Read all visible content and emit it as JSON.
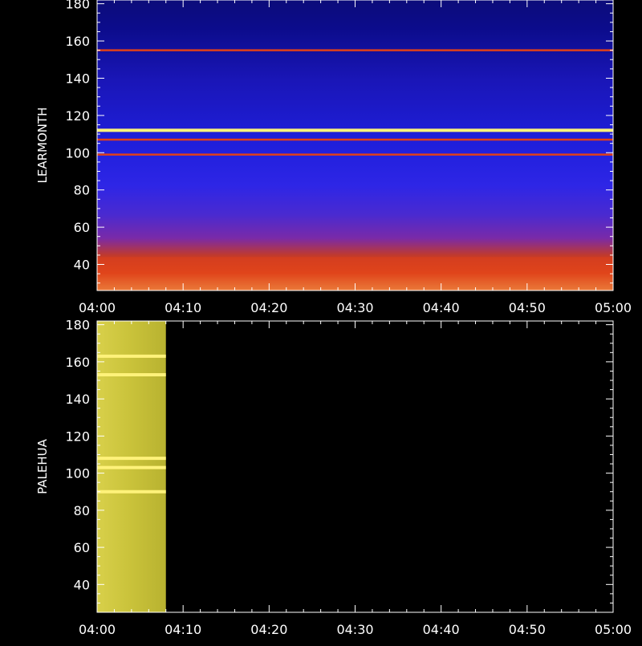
{
  "colors": {
    "background": "#000000",
    "axis": "#ffffff",
    "low_power": "#0a0a80",
    "mid_power": "#3a2ae0",
    "high_power": "#e0401a",
    "saturation": "#fff27a"
  },
  "chart_data": [
    {
      "type": "heatmap",
      "title": "",
      "ylabel": "LEARMONTH",
      "xlabel": "",
      "x_start": "04:00",
      "x_end": "05:00",
      "xticks": [
        "04:00",
        "04:10",
        "04:20",
        "04:30",
        "04:40",
        "04:50",
        "05:00"
      ],
      "ylim": [
        26,
        182
      ],
      "yticks": [
        40,
        60,
        80,
        100,
        120,
        140,
        160,
        180
      ],
      "colormap": "blue-red-yellow",
      "data_coverage": [
        "04:00",
        "05:00"
      ],
      "features": [
        {
          "kind": "line",
          "freq": 112,
          "level": "saturated"
        },
        {
          "kind": "line",
          "freq": 155,
          "level": "high"
        },
        {
          "kind": "line",
          "freq": 107,
          "level": "high"
        },
        {
          "kind": "line",
          "freq": 99,
          "level": "high"
        },
        {
          "kind": "band",
          "freq_range": [
            26,
            44
          ],
          "level": "high"
        }
      ]
    },
    {
      "type": "heatmap",
      "title": "",
      "ylabel": "PALEHUA",
      "xlabel": "",
      "x_start": "04:00",
      "x_end": "05:00",
      "xticks": [
        "04:00",
        "04:10",
        "04:20",
        "04:30",
        "04:40",
        "04:50",
        "05:00"
      ],
      "ylim": [
        25,
        182
      ],
      "yticks": [
        40,
        60,
        80,
        100,
        120,
        140,
        160,
        180
      ],
      "colormap": "blue-red-yellow",
      "data_coverage": [
        "04:00",
        "04:08"
      ],
      "features": [
        {
          "kind": "line",
          "freq": 163,
          "level": "saturated"
        },
        {
          "kind": "line",
          "freq": 153,
          "level": "saturated"
        },
        {
          "kind": "line",
          "freq": 108,
          "level": "saturated"
        },
        {
          "kind": "line",
          "freq": 103,
          "level": "saturated"
        },
        {
          "kind": "line",
          "freq": 90,
          "level": "saturated"
        }
      ]
    }
  ]
}
